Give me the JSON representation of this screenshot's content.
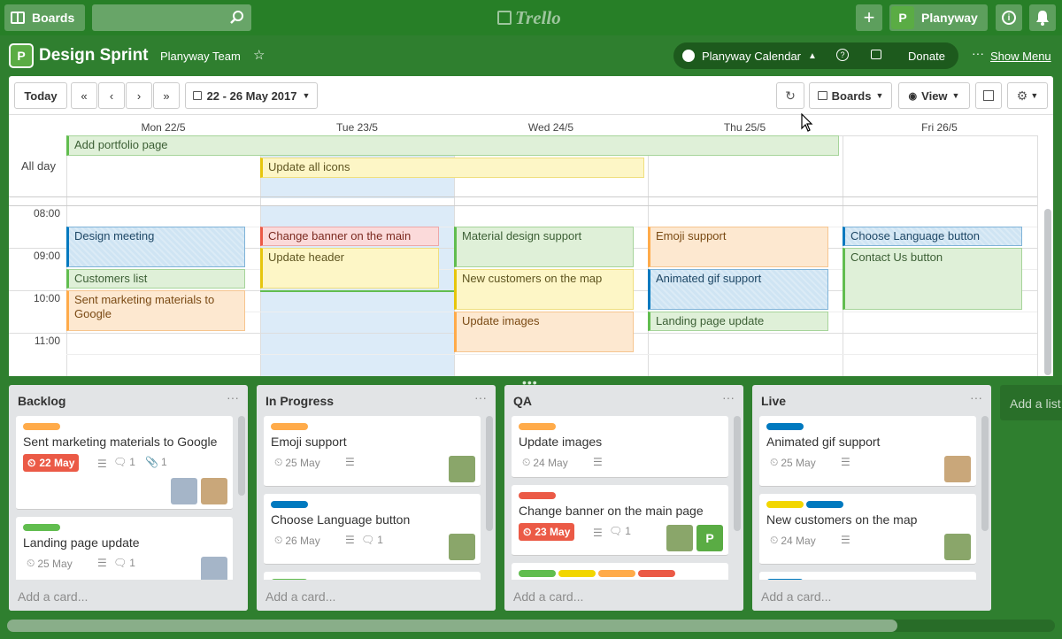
{
  "topbar": {
    "boards_label": "Boards",
    "logo_text": "Trello",
    "user_name": "Planyway"
  },
  "board": {
    "title": "Design Sprint",
    "team": "Planyway Team",
    "calendar_btn": "Planyway Calendar",
    "donate": "Donate",
    "show_menu": "Show Menu"
  },
  "calendar": {
    "toolbar": {
      "today": "Today",
      "first": "«",
      "prev": "‹",
      "next": "›",
      "last": "»",
      "date_range": "22 - 26 May 2017",
      "boards": "Boards",
      "view": "View"
    },
    "days": [
      "Mon 22/5",
      "Tue 23/5",
      "Wed 24/5",
      "Thu 25/5",
      "Fri 26/5"
    ],
    "all_day_label": "All day",
    "times": [
      "08:00",
      "09:00",
      "10:00",
      "11:00"
    ],
    "allday_events": [
      "Add portfolio page",
      "Update all icons"
    ],
    "events": [
      "Design meeting",
      "Customers list",
      "Sent marketing materials to Google",
      "Change banner on the main",
      "Update header",
      "Material design support",
      "New customers on the map",
      "Update images",
      "Emoji support",
      "Animated gif support",
      "Landing page update",
      "Choose Language button",
      "Contact Us button"
    ]
  },
  "lists": [
    {
      "title": "Backlog",
      "cards": [
        {
          "title": "Sent marketing materials to Google",
          "due": "22 May",
          "comments": "1",
          "attachments": "1"
        },
        {
          "title": "Landing page update",
          "date": "25 May",
          "comments": "1"
        }
      ],
      "add": "Add a card..."
    },
    {
      "title": "In Progress",
      "cards": [
        {
          "title": "Emoji support",
          "date": "25 May"
        },
        {
          "title": "Choose Language button",
          "date": "26 May",
          "comments": "1"
        }
      ],
      "add": "Add a card..."
    },
    {
      "title": "QA",
      "cards": [
        {
          "title": "Update images",
          "date": "24 May"
        },
        {
          "title": "Change banner on the main page",
          "due": "23 May",
          "comments": "1"
        }
      ],
      "add": "Add a card..."
    },
    {
      "title": "Live",
      "cards": [
        {
          "title": "Animated gif support",
          "date": "25 May"
        },
        {
          "title": "New customers on the map",
          "date": "24 May"
        }
      ],
      "add": "Add a card..."
    }
  ],
  "add_list": "Add a list",
  "colors": {
    "green": "#61bd4f",
    "yellow": "#f2d600",
    "orange": "#ffab4a",
    "red": "#eb5a46",
    "blue": "#0079bf",
    "board_bg": "#2f7f2f"
  }
}
